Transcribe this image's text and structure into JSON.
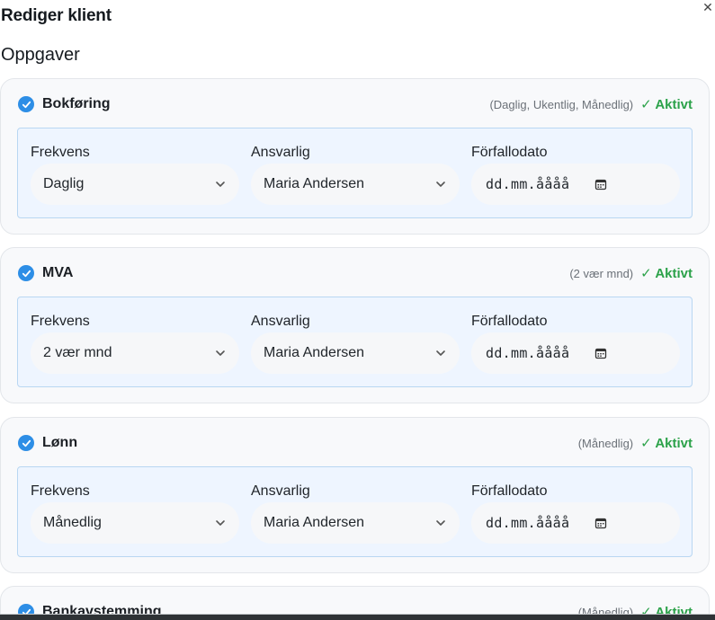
{
  "modal": {
    "title": "Rediger klient",
    "close_icon": "close-icon",
    "section_title": "Oppgaver"
  },
  "field_labels": {
    "frequency": "Frekvens",
    "responsible": "Ansvarlig",
    "due_date": "Förfallodato"
  },
  "tasks": [
    {
      "name": "Bokføring",
      "frequency_summary": "(Daglig, Ukentlig, Månedlig)",
      "status": "✓ Aktivt",
      "frequency": "Daglig",
      "responsible": "Maria Andersen",
      "due_date_placeholder": "dd.mm.åååå"
    },
    {
      "name": "MVA",
      "frequency_summary": "(2 vær mnd)",
      "status": "✓ Aktivt",
      "frequency": "2 vær mnd",
      "responsible": "Maria Andersen",
      "due_date_placeholder": "dd.mm.åååå"
    },
    {
      "name": "Lønn",
      "frequency_summary": "(Månedlig)",
      "status": "✓ Aktivt",
      "frequency": "Månedlig",
      "responsible": "Maria Andersen",
      "due_date_placeholder": "dd.mm.åååå"
    },
    {
      "name": "Bankavstemming",
      "frequency_summary": "(Månedlig)",
      "status": "✓ Aktivt"
    }
  ],
  "icons": {
    "checked": "check-circle-icon",
    "dropdown": "chevron-down-icon",
    "date": "calendar-icon"
  },
  "colors": {
    "check_blue": "#2d8ee6",
    "status_green": "#2ca24a",
    "panel_bg": "#eef5ff",
    "panel_border": "#b9d7f2",
    "card_bg": "#f8f9fb"
  }
}
